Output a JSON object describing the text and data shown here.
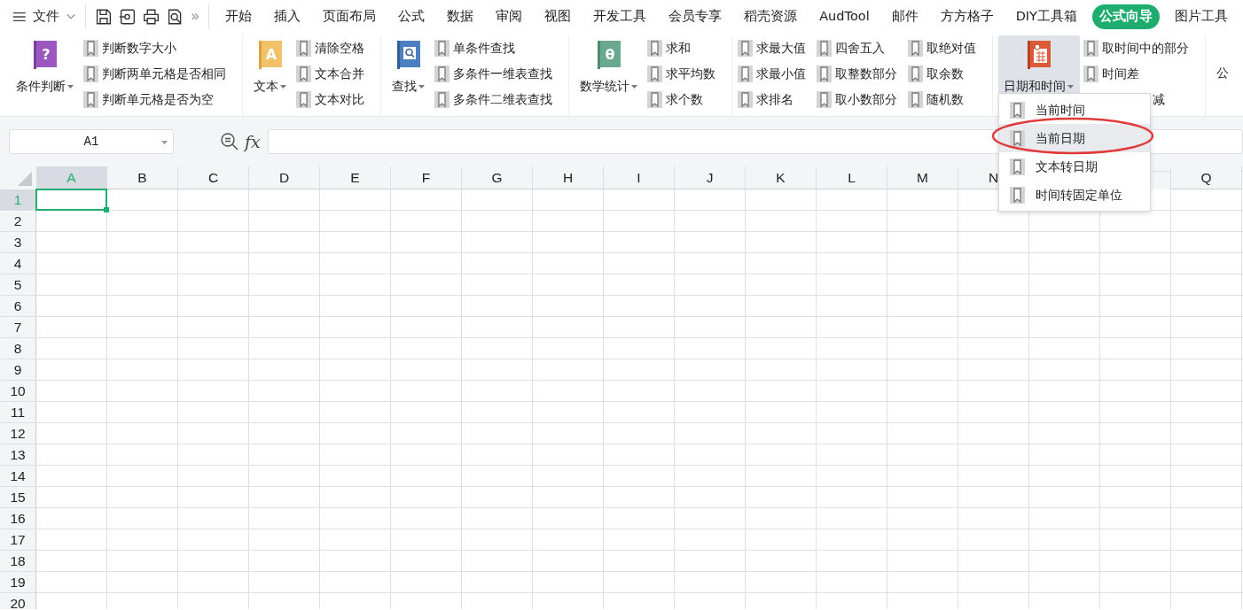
{
  "menu": {
    "file_label": "文件",
    "more": "»",
    "tabs": [
      {
        "label": "开始",
        "selected": false
      },
      {
        "label": "插入",
        "selected": false
      },
      {
        "label": "页面布局",
        "selected": false
      },
      {
        "label": "公式",
        "selected": false
      },
      {
        "label": "数据",
        "selected": false
      },
      {
        "label": "审阅",
        "selected": false
      },
      {
        "label": "视图",
        "selected": false
      },
      {
        "label": "开发工具",
        "selected": false
      },
      {
        "label": "会员专享",
        "selected": false
      },
      {
        "label": "稻壳资源",
        "selected": false
      },
      {
        "label": "AudTool",
        "selected": false
      },
      {
        "label": "邮件",
        "selected": false
      },
      {
        "label": "方方格子",
        "selected": false
      },
      {
        "label": "DIY工具箱",
        "selected": false
      },
      {
        "label": "公式向导",
        "selected": true
      },
      {
        "label": "图片工具",
        "selected": false
      }
    ]
  },
  "ribbon": {
    "groups": [
      {
        "button": {
          "label": "条件判断",
          "kind": "question",
          "icon_text": "?",
          "expanded": false
        },
        "columns": [
          [
            {
              "label": "判断数字大小"
            },
            {
              "label": "判断两单元格是否相同"
            },
            {
              "label": "判断单元格是否为空"
            }
          ]
        ]
      },
      {
        "button": {
          "label": "文本",
          "kind": "letter",
          "icon_text": "A",
          "expanded": false
        },
        "columns": [
          [
            {
              "label": "清除空格"
            },
            {
              "label": "文本合并"
            },
            {
              "label": "文本对比"
            }
          ]
        ]
      },
      {
        "button": {
          "label": "查找",
          "kind": "search",
          "expanded": false
        },
        "columns": [
          [
            {
              "label": "单条件查找"
            },
            {
              "label": "多条件一维表查找"
            },
            {
              "label": "多条件二维表查找"
            }
          ]
        ]
      },
      {
        "button": {
          "label": "数学统计",
          "kind": "theta",
          "icon_text": "θ",
          "expanded": false
        },
        "columns": [
          [
            {
              "label": "求和"
            },
            {
              "label": "求平均数"
            },
            {
              "label": "求个数"
            }
          ]
        ]
      },
      {
        "columns": [
          [
            {
              "label": "求最大值"
            },
            {
              "label": "求最小值"
            },
            {
              "label": "求排名"
            }
          ],
          [
            {
              "label": "四舍五入"
            },
            {
              "label": "取整数部分"
            },
            {
              "label": "取小数部分"
            }
          ],
          [
            {
              "label": "取绝对值"
            },
            {
              "label": "取余数"
            },
            {
              "label": "随机数"
            }
          ]
        ]
      },
      {
        "button": {
          "label": "日期和时间",
          "kind": "calendar",
          "expanded": true
        },
        "columns": [
          [
            {
              "label": "取时间中的部分"
            },
            {
              "label": "时间差"
            },
            {
              "label": "减",
              "partial": true
            }
          ]
        ]
      },
      {
        "cut_label": "公"
      }
    ]
  },
  "dropdown": {
    "items": [
      {
        "label": "当前时间",
        "selected": false
      },
      {
        "label": "当前日期",
        "selected": true
      },
      {
        "label": "文本转日期",
        "selected": false
      },
      {
        "label": "时间转固定单位",
        "selected": false
      }
    ]
  },
  "formula_bar": {
    "cell": "A1",
    "fx": "fx"
  },
  "sheet": {
    "columns": [
      {
        "label": "A",
        "selected": true
      },
      {
        "label": "B",
        "selected": false
      },
      {
        "label": "C",
        "selected": false
      },
      {
        "label": "D",
        "selected": false
      },
      {
        "label": "E",
        "selected": false
      },
      {
        "label": "F",
        "selected": false
      },
      {
        "label": "G",
        "selected": false
      },
      {
        "label": "H",
        "selected": false
      },
      {
        "label": "I",
        "selected": false
      },
      {
        "label": "J",
        "selected": false
      },
      {
        "label": "K",
        "selected": false
      },
      {
        "label": "L",
        "selected": false
      },
      {
        "label": "M",
        "selected": false
      },
      {
        "label": "N",
        "selected": false
      },
      {},
      {},
      {
        "label": "Q",
        "selected": false
      }
    ],
    "rows": [
      {
        "label": "1",
        "selected": true
      },
      {
        "label": "2",
        "selected": false
      },
      {
        "label": "3",
        "selected": false
      },
      {
        "label": "4",
        "selected": false
      },
      {
        "label": "5",
        "selected": false
      },
      {
        "label": "6",
        "selected": false
      },
      {
        "label": "7",
        "selected": false
      },
      {
        "label": "8",
        "selected": false
      },
      {
        "label": "9",
        "selected": false
      },
      {
        "label": "10",
        "selected": false
      },
      {
        "label": "11",
        "selected": false
      },
      {
        "label": "12",
        "selected": false
      },
      {
        "label": "13",
        "selected": false
      },
      {
        "label": "14",
        "selected": false
      },
      {
        "label": "15",
        "selected": false
      },
      {
        "label": "16",
        "selected": false
      },
      {
        "label": "17",
        "selected": false
      },
      {
        "label": "18",
        "selected": false
      },
      {
        "label": "19",
        "selected": false
      },
      {
        "label": "20",
        "selected": false
      }
    ]
  }
}
